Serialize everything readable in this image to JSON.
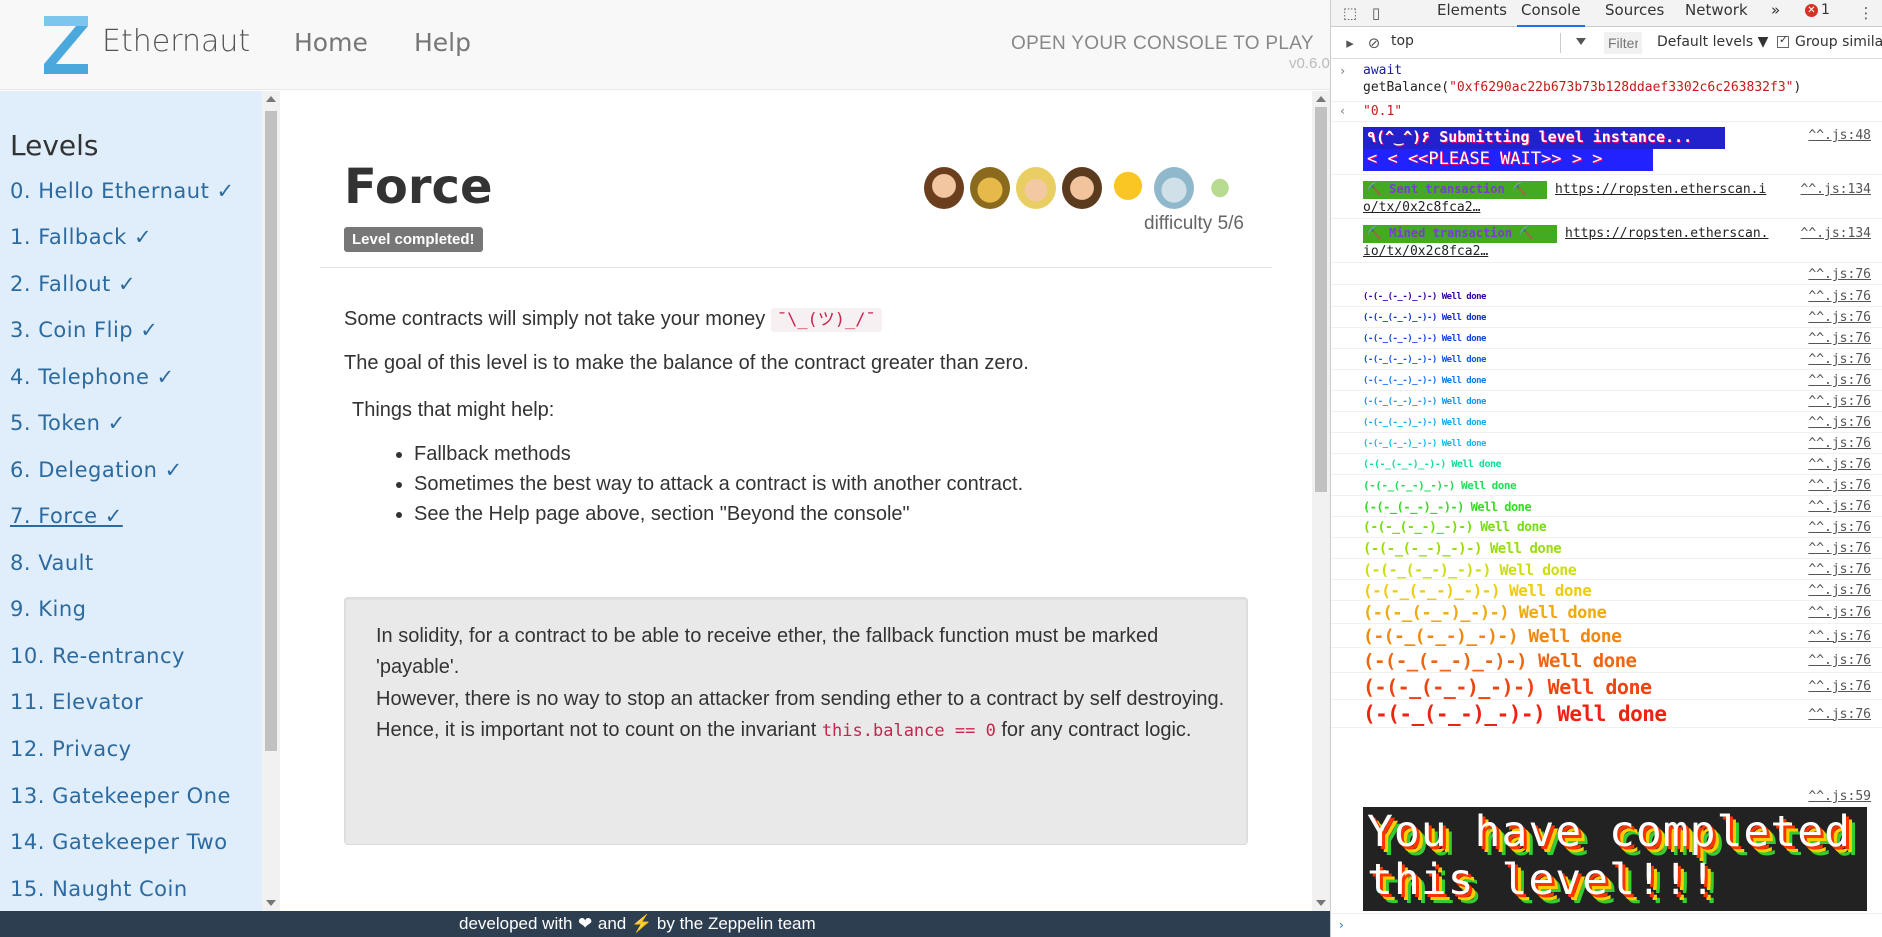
{
  "app": {
    "brand": "Ethernaut",
    "nav": {
      "home": "Home",
      "help": "Help"
    },
    "cta": "OPEN YOUR CONSOLE TO PLAY",
    "version": "v0.6.0",
    "colors": {
      "accent": "#2d6a9f",
      "sidebar_bg": "#dfeefa",
      "footer_bg": "#2c3e50"
    }
  },
  "sidebar": {
    "title": "Levels",
    "levels": [
      "0. Hello Ethernaut ✓",
      "1. Fallback ✓",
      "2. Fallout ✓",
      "3. Coin Flip ✓",
      "4. Telephone ✓",
      "5. Token ✓",
      "6. Delegation ✓",
      "7. Force ✓",
      "8. Vault",
      "9. King",
      "10. Re-entrancy",
      "11. Elevator",
      "12. Privacy",
      "13. Gatekeeper One",
      "14. Gatekeeper Two",
      "15. Naught Coin"
    ]
  },
  "level": {
    "title": "Force",
    "badge": "Level completed!",
    "difficulty": "difficulty 5/6",
    "intro": "Some contracts will simply not take your money",
    "shrug": "¯\\_(ツ)_/¯",
    "goal": "The goal of this level is to make the balance of the contract greater than zero.",
    "hints_title": "Things that might help:",
    "hints": [
      "Fallback methods",
      "Sometimes the best way to attack a contract is with another contract.",
      "See the Help page above, section \"Beyond the console\""
    ],
    "well_p1": "In solidity, for a contract to be able to receive ether, the fallback function must be marked 'payable'.",
    "well_p2_before": "However, there is no way to stop an attacker from sending ether to a contract by self destroying. Hence, it is important not to count on the invariant",
    "well_code": "this.balance == 0",
    "well_p2_after": "for any contract logic."
  },
  "footer": {
    "before": "developed with",
    "middle": "and",
    "after": "by the Zeppelin team"
  },
  "devtools": {
    "tabs": [
      "Elements",
      "Console",
      "Sources",
      "Network"
    ],
    "active_tab": "Console",
    "more": "»",
    "error_count": "1",
    "context": "top",
    "filter_placeholder": "Filter",
    "levels": "Default levels ▼",
    "group_similar": "Group simila",
    "console": {
      "input_line1": "await",
      "input_fn": "getBalance(",
      "input_arg": "\"0xf6290ac22b673b73b128ddaef3302c6c263832f3\"",
      "input_close": ")",
      "result": "\"0.1\"",
      "submitting": "٩(^‿^)۶ Submitting level instance...",
      "please_wait": "< < <<PLEASE WAIT>> > >",
      "sent_tx": "⛏️ Sent transaction ⛏️",
      "sent_url": "https://ropsten.etherscan.io/tx/0x2c8fca2…",
      "mined_tx": "⛏️ Mined transaction ⛏️",
      "mined_url": "https://ropsten.etherscan.io/tx/0x2c8fca2…",
      "src_48": "^^.js:48",
      "src_134": "^^.js:134",
      "src_76": "^^.js:76",
      "src_59": "^^.js:59",
      "well_done_lines": [
        "(-(-_(-_-)_-)-) Well done",
        "(-(-_(-_-)_-)-) Well done",
        "(-(-_(-_-)_-)-) Well done",
        "(-(-_(-_-)_-)-) Well done",
        "(-(-_(-_-)_-)-) Well done",
        "(-(-_(-_-)_-)-) Well done",
        "(-(-_(-_-)_-)-) Well done",
        "(-(-_(-_-)_-)-) Well done",
        "(-(-_(-_-)_-)-) Well done",
        "(-(-_(-_-)_-)-) Well done",
        "(-(-_(-_-)_-)-) Well done",
        "(-(-_(-_-)_-)-) Well done",
        "(-(-_(-_-)_-)-) Well done",
        "(-(-_(-_-)_-)-) Well done",
        "(-(-_(-_-)_-)-) Well done",
        "(-(-_(-_-)_-)-) Well done",
        "(-(-_(-_-)_-)-) Well done",
        "(-(-_(-_-)_-)-) Well done",
        "(-(-_(-_-)_-)-) Well done",
        "(-(-_(-_-)_-)-) Well done"
      ],
      "well_done_colors": [
        "#3300aa",
        "#1133cc",
        "#1144dd",
        "#1155ee",
        "#1177ee",
        "#1199ee",
        "#11aaee",
        "#11bbee",
        "#11dd99",
        "#22dd55",
        "#33dd22",
        "#77dd11",
        "#99dd11",
        "#ccdd11",
        "#eecc11",
        "#eeaa11",
        "#ee8811",
        "#ee6611",
        "#ee4411",
        "#ee2211"
      ],
      "final_line1": "You have completed",
      "final_line2": "this level!!!"
    }
  }
}
